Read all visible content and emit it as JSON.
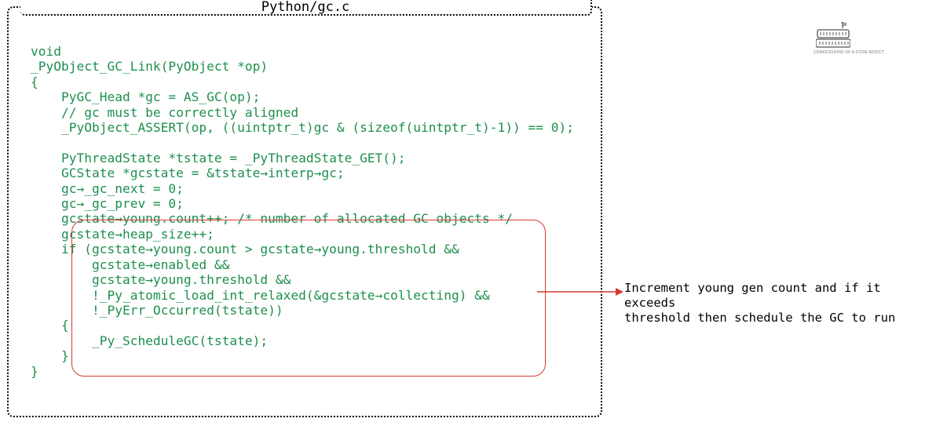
{
  "panel": {
    "title": "Python/gc.c"
  },
  "code": {
    "lines": [
      "void",
      "_PyObject_GC_Link(PyObject *op)",
      "{",
      "    PyGC_Head *gc = AS_GC(op);",
      "    // gc must be correctly aligned",
      "    _PyObject_ASSERT(op, ((uintptr_t)gc & (sizeof(uintptr_t)-1)) == 0);",
      "",
      "    PyThreadState *tstate = _PyThreadState_GET();",
      "    GCState *gcstate = &tstate→interp→gc;",
      "    gc→_gc_next = 0;",
      "    gc→_gc_prev = 0;",
      "    gcstate→young.count++; /* number of allocated GC objects */",
      "    gcstate→heap_size++;",
      "    if (gcstate→young.count > gcstate→young.threshold &&",
      "        gcstate→enabled &&",
      "        gcstate→young.threshold &&",
      "        !_Py_atomic_load_int_relaxed(&gcstate→collecting) &&",
      "        !_PyErr_Occurred(tstate))",
      "    {",
      "        _Py_ScheduleGC(tstate);",
      "    }",
      "}"
    ]
  },
  "annotation": {
    "text": "Increment young gen count and if it exceeds\nthreshold then schedule the GC to run"
  },
  "brand": {
    "caption": "CONFESSIONS OF A CODE ADDICT"
  },
  "colors": {
    "code_text": "#1e8f4e",
    "highlight_border": "#d63a2f",
    "arrow": "#d63a2f",
    "panel_border": "#000000"
  }
}
